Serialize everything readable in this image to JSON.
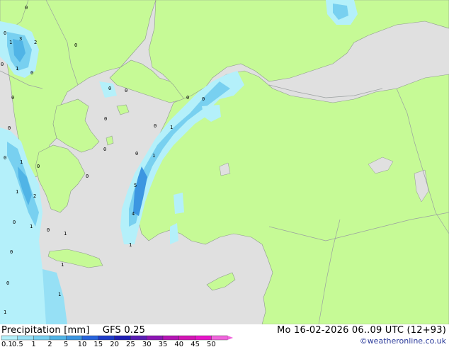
{
  "legend": {
    "title": "Precipitation [mm]",
    "model": "GFS 0.25",
    "valid_time": "Mo 16-02-2026 06..09 UTC (12+93)",
    "credit": "©weatheronline.co.uk",
    "scale_labels": [
      "0.1",
      "0.5",
      "1",
      "2",
      "5",
      "10",
      "15",
      "20",
      "25",
      "30",
      "35",
      "40",
      "45",
      "50"
    ],
    "scale_colors": [
      "#b4f0fa",
      "#96e0f5",
      "#78d0f0",
      "#50b4e6",
      "#3c96e1",
      "#2864dc",
      "#1e3cc8",
      "#1e1eb4",
      "#5a1eb4",
      "#8c14b4",
      "#b414b4",
      "#d214b4",
      "#e614c8",
      "#f064dc"
    ]
  },
  "colors": {
    "land": "#c6fa96",
    "sea": "#e0e0e0",
    "border": "#9aa0a0"
  },
  "map_labels": [
    "0",
    "3",
    "2",
    "1",
    "0",
    "0",
    "1",
    "0",
    "0",
    "0",
    "0",
    "0",
    "0",
    "0",
    "0",
    "0",
    "1",
    "0",
    "1",
    "0",
    "0",
    "0",
    "1",
    "0",
    "1",
    "2",
    "5",
    "4",
    "0",
    "1",
    "1",
    "0",
    "0",
    "1",
    "0",
    "1",
    "1",
    "0",
    "1"
  ]
}
